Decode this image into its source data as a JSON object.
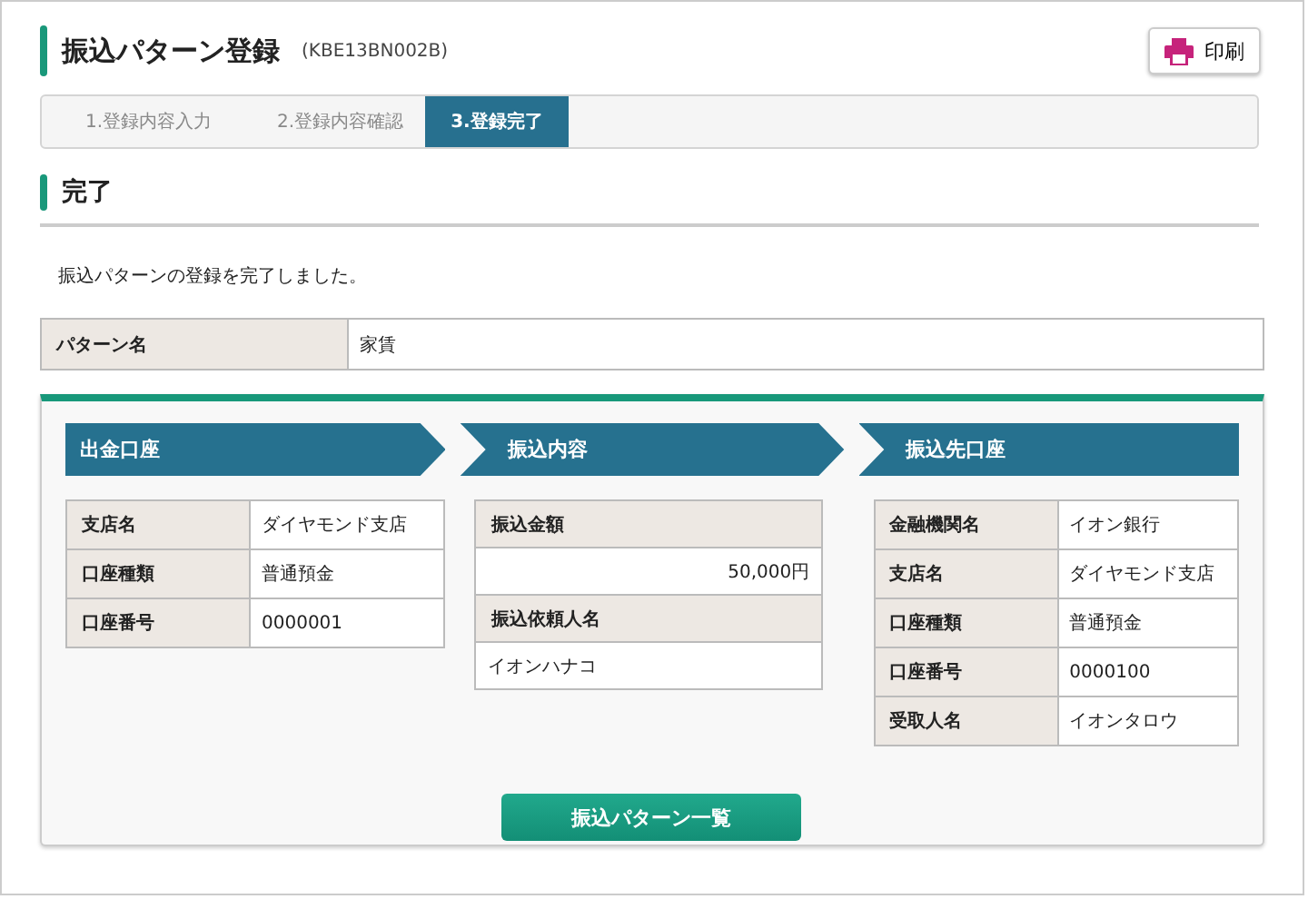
{
  "title": "振込パターン登録",
  "screen_id": "(KBE13BN002B)",
  "print_button": "印刷",
  "steps": [
    {
      "label": "1.登録内容入力",
      "selected": false
    },
    {
      "label": "2.登録内容確認",
      "selected": false
    },
    {
      "label": "3.登録完了",
      "selected": true
    }
  ],
  "section_title": "完了",
  "message": "振込パターンの登録を完了しました。",
  "pattern": {
    "label": "パターン名",
    "value": "家賃"
  },
  "panels": [
    {
      "heading": "出金口座",
      "kind": "side",
      "rows": [
        {
          "label": "支店名",
          "value": "ダイヤモンド支店"
        },
        {
          "label": "口座種類",
          "value": "普通預金"
        },
        {
          "label": "口座番号",
          "value": "0000001"
        }
      ]
    },
    {
      "heading": "振込内容",
      "kind": "stacked",
      "rows": [
        {
          "label": "振込金額",
          "value": "50,000円",
          "kind": "amount"
        },
        {
          "label": "振込依頼人名",
          "value": "イオンハナコ",
          "kind": "text"
        }
      ]
    },
    {
      "heading": "振込先口座",
      "kind": "side",
      "rows": [
        {
          "label": "金融機関名",
          "value": "イオン銀行"
        },
        {
          "label": "支店名",
          "value": "ダイヤモンド支店"
        },
        {
          "label": "口座種類",
          "value": "普通預金"
        },
        {
          "label": "口座番号",
          "value": "0000100"
        },
        {
          "label": "受取人名",
          "value": "イオンタロウ"
        }
      ]
    }
  ],
  "list_button": "振込パターン一覧"
}
